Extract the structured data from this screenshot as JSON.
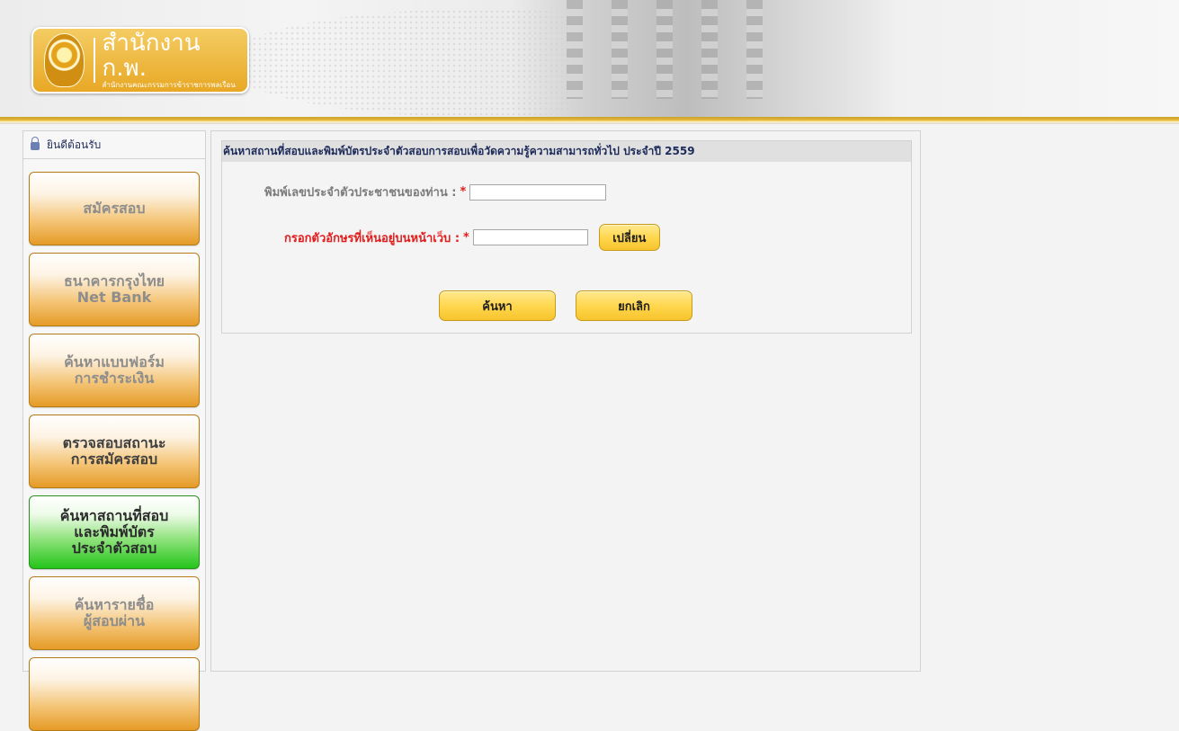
{
  "header": {
    "logo_title": "สำนักงาน ก.พ.",
    "logo_subtitle": "สำนักงานคณะกรรมการข้าราชการพลเรือน"
  },
  "sidebar": {
    "welcome": "ยินดีต้อนรับ",
    "items": [
      {
        "line1": "สมัครสอบ",
        "line2": "",
        "line3": ""
      },
      {
        "line1": "ธนาคารกรุงไทย",
        "line2": "Net Bank",
        "line3": ""
      },
      {
        "line1": "ค้นหาแบบฟอร์ม",
        "line2": "การชำระเงิน",
        "line3": ""
      },
      {
        "line1": "ตรวจสอบสถานะ",
        "line2": "การสมัครสอบ",
        "line3": ""
      },
      {
        "line1": "ค้นหาสถานที่สอบ",
        "line2": "และพิมพ์บัตร",
        "line3": "ประจำตัวสอบ"
      },
      {
        "line1": "ค้นหารายชื่อ",
        "line2": "ผู้สอบผ่าน",
        "line3": ""
      }
    ]
  },
  "main": {
    "panel_title": "ค้นหาสถานที่สอบและพิมพ์บัตรประจำตัวสอบการสอบเพื่อวัดความรู้ความสามารถทั่วไป ประจำปี 2559",
    "id_label": "พิมพ์เลขประจำตัวประชาชนของท่าน :",
    "id_value": "",
    "captcha_label": "กรอกตัวอักษรที่เห็นอยู่บนหน้าเว็บ :",
    "captcha_value": "",
    "required_mark": "*",
    "change_button": "เปลี่ยน",
    "search_button": "ค้นหา",
    "cancel_button": "ยกเลิก"
  },
  "colors": {
    "accent_gold": "#e8a825",
    "active_green": "#23c51a",
    "required_red": "#e31b1b",
    "title_navy": "#1d2b5a"
  }
}
